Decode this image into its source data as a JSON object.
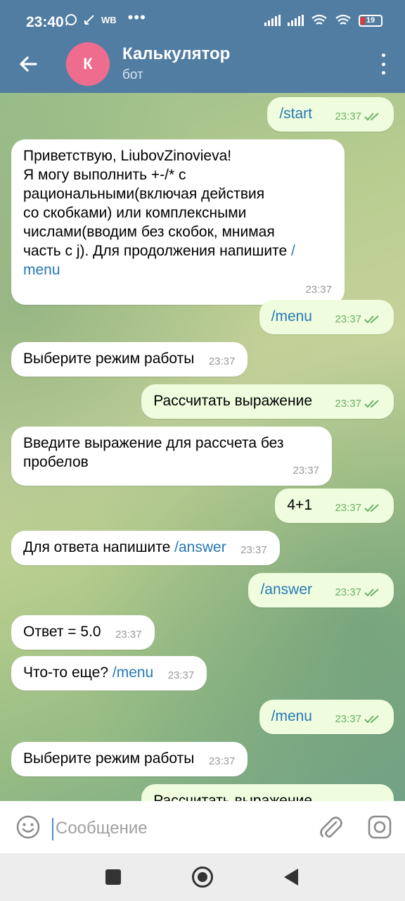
{
  "status_bar": {
    "time": "23:40",
    "carrier_badge": "WB",
    "overflow": "•••",
    "battery": "19"
  },
  "header": {
    "avatar_letter": "К",
    "title": "Калькулятор",
    "subtitle": "бот"
  },
  "messages": [
    {
      "dir": "out",
      "text": "",
      "link": "/start",
      "time": "23:37"
    },
    {
      "dir": "in",
      "text": "Приветствую, LiubovZinovieva!\nЯ могу выполнить +-/* с\nрациональными(включая действия\nсо скобками) или комплексными\nчислами(вводим без скобок, мнимая\nчасть с j). Для продолжения напишите ",
      "link": "/\nmenu",
      "time": "23:37"
    },
    {
      "dir": "out",
      "text": "",
      "link": "/menu",
      "time": "23:37"
    },
    {
      "dir": "in",
      "text": "Выберите режим работы",
      "link": "",
      "time": "23:37"
    },
    {
      "dir": "out",
      "text": "Рассчитать выражение",
      "link": "",
      "time": "23:37"
    },
    {
      "dir": "in",
      "text": "Введите выражение для рассчета без\nпробелов",
      "link": "",
      "time": "23:37"
    },
    {
      "dir": "out",
      "text": "4+1",
      "link": "",
      "time": "23:37"
    },
    {
      "dir": "in",
      "text": "Для ответа напишите ",
      "link": "/answer",
      "time": "23:37"
    },
    {
      "dir": "out",
      "text": "",
      "link": "/answer",
      "time": "23:37"
    },
    {
      "dir": "in",
      "text": "Ответ = 5.0",
      "link": "",
      "time": "23:37"
    },
    {
      "dir": "in",
      "text": "Что-то еще? ",
      "link": "/menu",
      "time": "23:37"
    },
    {
      "dir": "out",
      "text": "",
      "link": "/menu",
      "time": "23:37"
    },
    {
      "dir": "in",
      "text": "Выберите режим работы",
      "link": "",
      "time": "23:37"
    },
    {
      "dir": "out",
      "text": "Рассчитать выражение",
      "link": "",
      "time": ""
    }
  ],
  "input": {
    "placeholder": "Сообщение"
  },
  "colors": {
    "header": "#517DA2",
    "incoming_bubble": "#FFFFFF",
    "outgoing_bubble": "#EFFDDE",
    "link": "#2678B6",
    "avatar": "#EE6D8E"
  }
}
